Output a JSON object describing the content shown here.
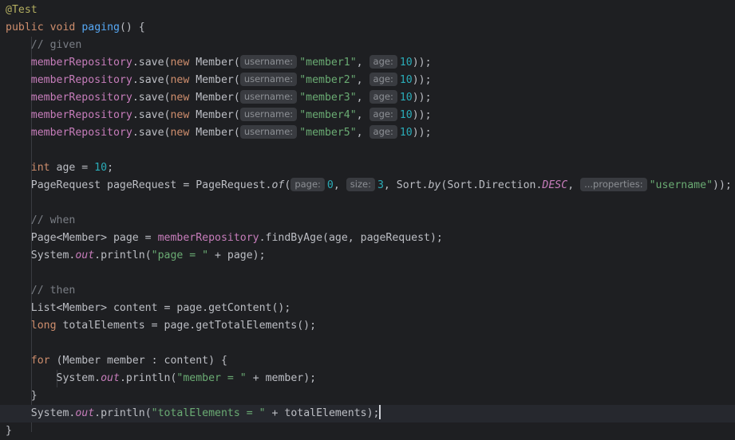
{
  "code": {
    "annotation": "@Test",
    "method_signature": {
      "kw_public": "public",
      "kw_void": "void",
      "name": "paging",
      "rest": "() {"
    },
    "comment_given": "// given",
    "save_calls": [
      {
        "receiver": "memberRepository",
        "method": ".save(",
        "kw_new": "new",
        "type": " Member(",
        "hint_username": "username:",
        "username": "\"member1\"",
        "sep": ", ",
        "hint_age": "age:",
        "age": "10",
        "end": "));"
      },
      {
        "receiver": "memberRepository",
        "method": ".save(",
        "kw_new": "new",
        "type": " Member(",
        "hint_username": "username:",
        "username": "\"member2\"",
        "sep": ", ",
        "hint_age": "age:",
        "age": "10",
        "end": "));"
      },
      {
        "receiver": "memberRepository",
        "method": ".save(",
        "kw_new": "new",
        "type": " Member(",
        "hint_username": "username:",
        "username": "\"member3\"",
        "sep": ", ",
        "hint_age": "age:",
        "age": "10",
        "end": "));"
      },
      {
        "receiver": "memberRepository",
        "method": ".save(",
        "kw_new": "new",
        "type": " Member(",
        "hint_username": "username:",
        "username": "\"member4\"",
        "sep": ", ",
        "hint_age": "age:",
        "age": "10",
        "end": "));"
      },
      {
        "receiver": "memberRepository",
        "method": ".save(",
        "kw_new": "new",
        "type": " Member(",
        "hint_username": "username:",
        "username": "\"member5\"",
        "sep": ", ",
        "hint_age": "age:",
        "age": "10",
        "end": "));"
      }
    ],
    "age_decl": {
      "kw_int": "int",
      "middle": " age = ",
      "value": "10",
      "end": ";"
    },
    "page_request": {
      "start": "PageRequest pageRequest = PageRequest.",
      "of": "of",
      "open": "(",
      "hint_page": "page:",
      "page_val": "0",
      "sep1": ", ",
      "hint_size": "size:",
      "size_val": "3",
      "mid": ", Sort.",
      "by": "by",
      "mid2": "(Sort.Direction.",
      "desc": "DESC",
      "sep2": ", ",
      "hint_props": "...properties:",
      "prop_val": "\"username\"",
      "end": "));"
    },
    "comment_when": "// when",
    "find_line": {
      "start": "Page<Member> page = ",
      "receiver": "memberRepository",
      "end": ".findByAge(age, pageRequest);"
    },
    "println_page": {
      "start": "System.",
      "out": "out",
      "mid": ".println(",
      "str": "\"page = \"",
      "end": " + page);"
    },
    "comment_then": "// then",
    "content_line": "List<Member> content = page.getContent();",
    "total_line": {
      "kw_long": "long",
      "rest": " totalElements = page.getTotalElements();"
    },
    "for_line": {
      "kw_for": "for",
      "rest": " (Member member : content) {"
    },
    "println_member": {
      "start": "System.",
      "out": "out",
      "mid": ".println(",
      "str": "\"member = \"",
      "end": " + member);"
    },
    "for_close": "}",
    "println_total": {
      "start": "System.",
      "out": "out",
      "mid": ".println(",
      "str": "\"totalElements = \"",
      "end": " + totalElements);"
    },
    "method_close": "}"
  }
}
